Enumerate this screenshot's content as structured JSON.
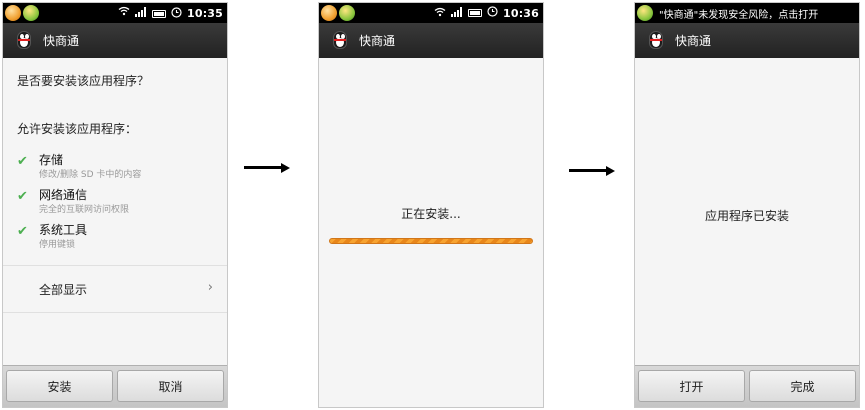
{
  "screens": [
    {
      "status": {
        "time": "10:35"
      },
      "title": "快商通",
      "question": "是否要安装该应用程序？",
      "permissions_title": "允许安装该应用程序：",
      "permissions": [
        {
          "name": "存储",
          "desc": "修改/删除 SD 卡中的内容"
        },
        {
          "name": "网络通信",
          "desc": "完全的互联网访问权限"
        },
        {
          "name": "系统工具",
          "desc": "停用键锁"
        }
      ],
      "show_all": "全部显示",
      "buttons": {
        "install": "安装",
        "cancel": "取消"
      }
    },
    {
      "status": {
        "time": "10:36"
      },
      "title": "快商通",
      "installing": "正在安装...",
      "progress": 1.0
    },
    {
      "status": {
        "notification": "\"快商通\"未发现安全风险，点击打开"
      },
      "title": "快商通",
      "installed": "应用程序已安装",
      "buttons": {
        "open": "打开",
        "done": "完成"
      }
    }
  ],
  "icons": {
    "status_left": [
      "app-notification-icon",
      "qq-notification-icon"
    ],
    "status_right": [
      "wifi-icon",
      "signal-icon",
      "battery-icon",
      "alarm-icon"
    ],
    "security_icon": "security-shield-icon",
    "app_icon": "penguin-icon",
    "check": "check-icon",
    "chevron": "chevron-right-icon",
    "arrow": "right-arrow-icon"
  },
  "colors": {
    "check": "#4caf50",
    "progress": "#f7a330",
    "titlebar": "#2a2a2a",
    "statusbar": "#000000"
  }
}
